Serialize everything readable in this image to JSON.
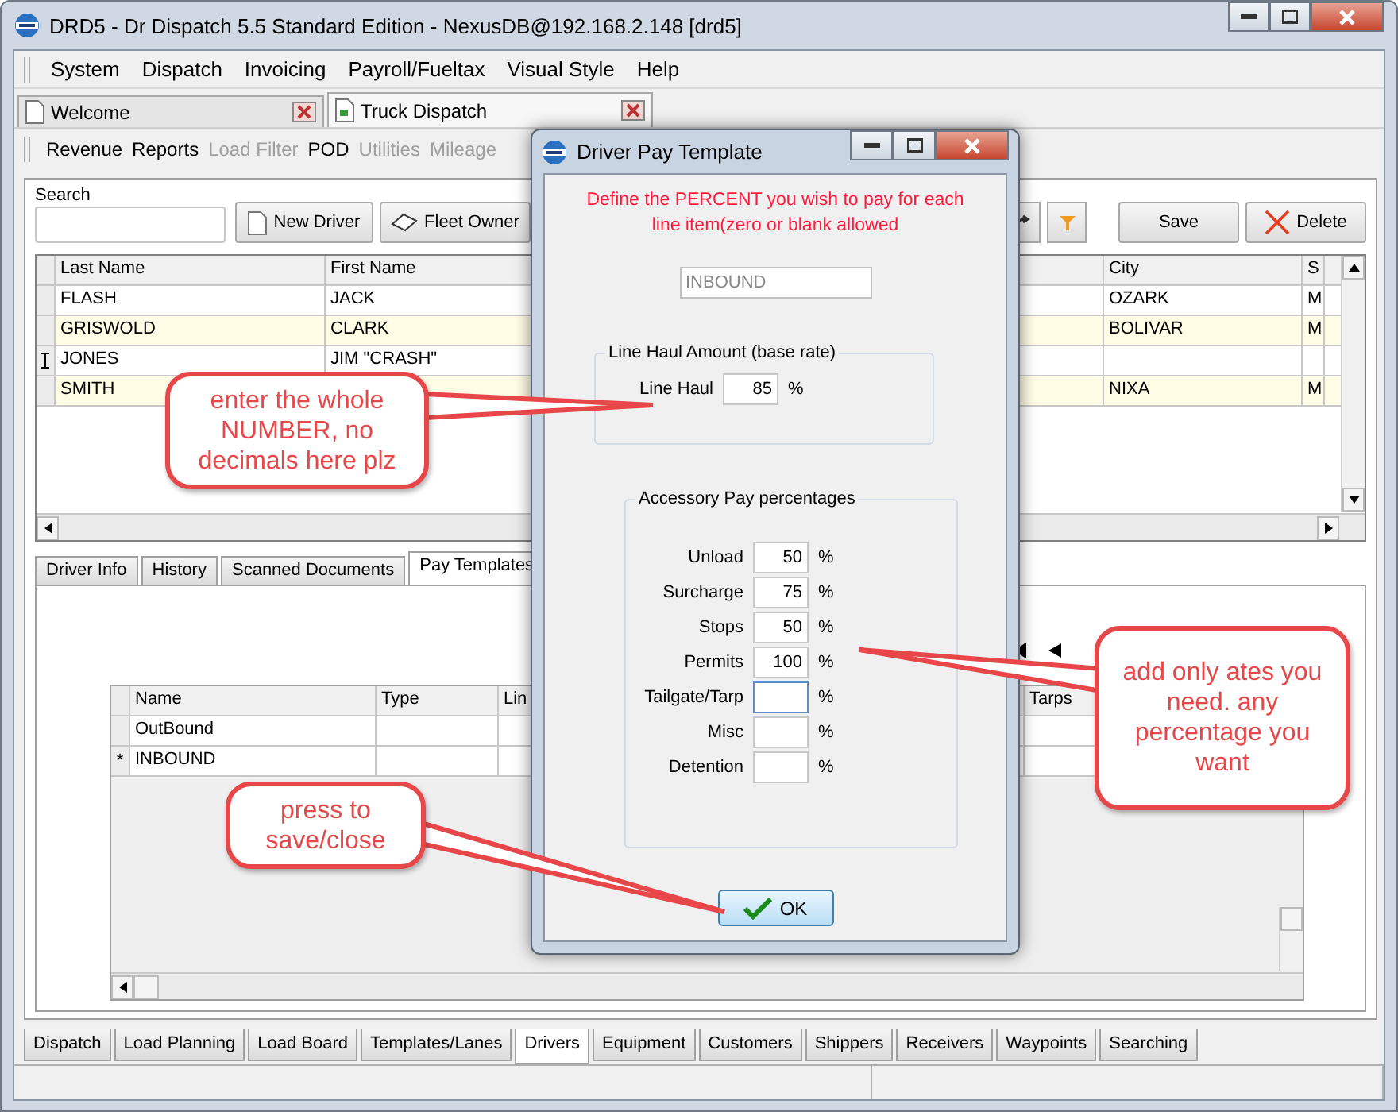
{
  "window": {
    "title": "DRD5 - Dr Dispatch 5.5 Standard Edition - NexusDB@192.168.2.148 [drd5]"
  },
  "menu": [
    "System",
    "Dispatch",
    "Invoicing",
    "Payroll/Fueltax",
    "Visual Style",
    "Help"
  ],
  "doc_tabs": [
    {
      "label": "Welcome",
      "selected": false
    },
    {
      "label": "Truck Dispatch",
      "selected": true
    }
  ],
  "toolbar": [
    {
      "label": "Revenue",
      "disabled": false
    },
    {
      "label": "Reports",
      "disabled": false
    },
    {
      "label": "Load Filter",
      "disabled": true
    },
    {
      "label": "POD",
      "disabled": false
    },
    {
      "label": "Utilities",
      "disabled": true
    },
    {
      "label": "Mileage",
      "disabled": true
    }
  ],
  "search": {
    "label": "Search"
  },
  "buttons": [
    {
      "label": "New Driver",
      "kind": "new"
    },
    {
      "label": "Fleet Owner",
      "kind": "fleet"
    }
  ],
  "actions": [
    {
      "label": "Save",
      "kind": "plain"
    },
    {
      "label": "Delete",
      "kind": "delete"
    }
  ],
  "drivers": {
    "columns": [
      "Last Name",
      "First Name",
      "City",
      "S"
    ],
    "rows": [
      {
        "cells": [
          "FLASH",
          "JACK",
          "OZARK",
          "M"
        ],
        "current": false
      },
      {
        "cells": [
          "GRISWOLD",
          "CLARK",
          "BOLIVAR",
          "M"
        ],
        "current": false
      },
      {
        "cells": [
          "JONES",
          "JIM \"CRASH\""
        ],
        "current": true
      },
      {
        "cells": [
          "SMITH",
          null,
          "NIXA",
          "M"
        ],
        "current": false
      }
    ]
  },
  "detail_tabs": [
    {
      "label": "Driver Info",
      "selected": false
    },
    {
      "label": "History",
      "selected": false
    },
    {
      "label": "Scanned Documents",
      "selected": false
    },
    {
      "label": "Pay Templates",
      "selected": true
    }
  ],
  "pay_templates": {
    "columns": [
      "Name",
      "Type",
      "Lin",
      "Tarps"
    ],
    "rows": [
      {
        "cells": [
          "OutBound"
        ]
      },
      {
        "cells": [
          "INBOUND"
        ],
        "marker": "*"
      }
    ]
  },
  "bottom_tabs": [
    {
      "label": "Dispatch",
      "selected": false
    },
    {
      "label": "Load Planning",
      "selected": false
    },
    {
      "label": "Load Board",
      "selected": false
    },
    {
      "label": "Templates/Lanes",
      "selected": false
    },
    {
      "label": "Drivers",
      "selected": true
    },
    {
      "label": "Equipment",
      "selected": false
    },
    {
      "label": "Customers",
      "selected": false
    },
    {
      "label": "Shippers",
      "selected": false
    },
    {
      "label": "Receivers",
      "selected": false
    },
    {
      "label": "Waypoints",
      "selected": false
    },
    {
      "label": "Searching",
      "selected": false
    }
  ],
  "dialog": {
    "title": "Driver Pay Template",
    "instruction": "Define the PERCENT you wish to pay for each\nline item(zero or blank allowed",
    "template_name": "INBOUND",
    "line_haul_group": "Line Haul Amount (base rate)",
    "line_haul": {
      "label": "Line Haul",
      "value": "85",
      "unit": "%"
    },
    "accessory_group": "Accessory Pay percentages",
    "accessory": [
      {
        "label": "Unload",
        "value": "50",
        "unit": "%",
        "focused": false
      },
      {
        "label": "Surcharge",
        "value": "75",
        "unit": "%",
        "focused": false
      },
      {
        "label": "Stops",
        "value": "50",
        "unit": "%",
        "focused": false
      },
      {
        "label": "Permits",
        "value": "100",
        "unit": "%",
        "focused": false
      },
      {
        "label": "Tailgate/Tarp",
        "unit": "%",
        "focused": true
      },
      {
        "label": "Misc",
        "unit": "%",
        "focused": false
      },
      {
        "label": "Detention",
        "unit": "%",
        "focused": false
      }
    ],
    "ok": "OK"
  },
  "callouts": [
    "enter the whole NUMBER, no decimals here plz",
    "add only ates you need. any percentage you want",
    "press to save/close"
  ]
}
